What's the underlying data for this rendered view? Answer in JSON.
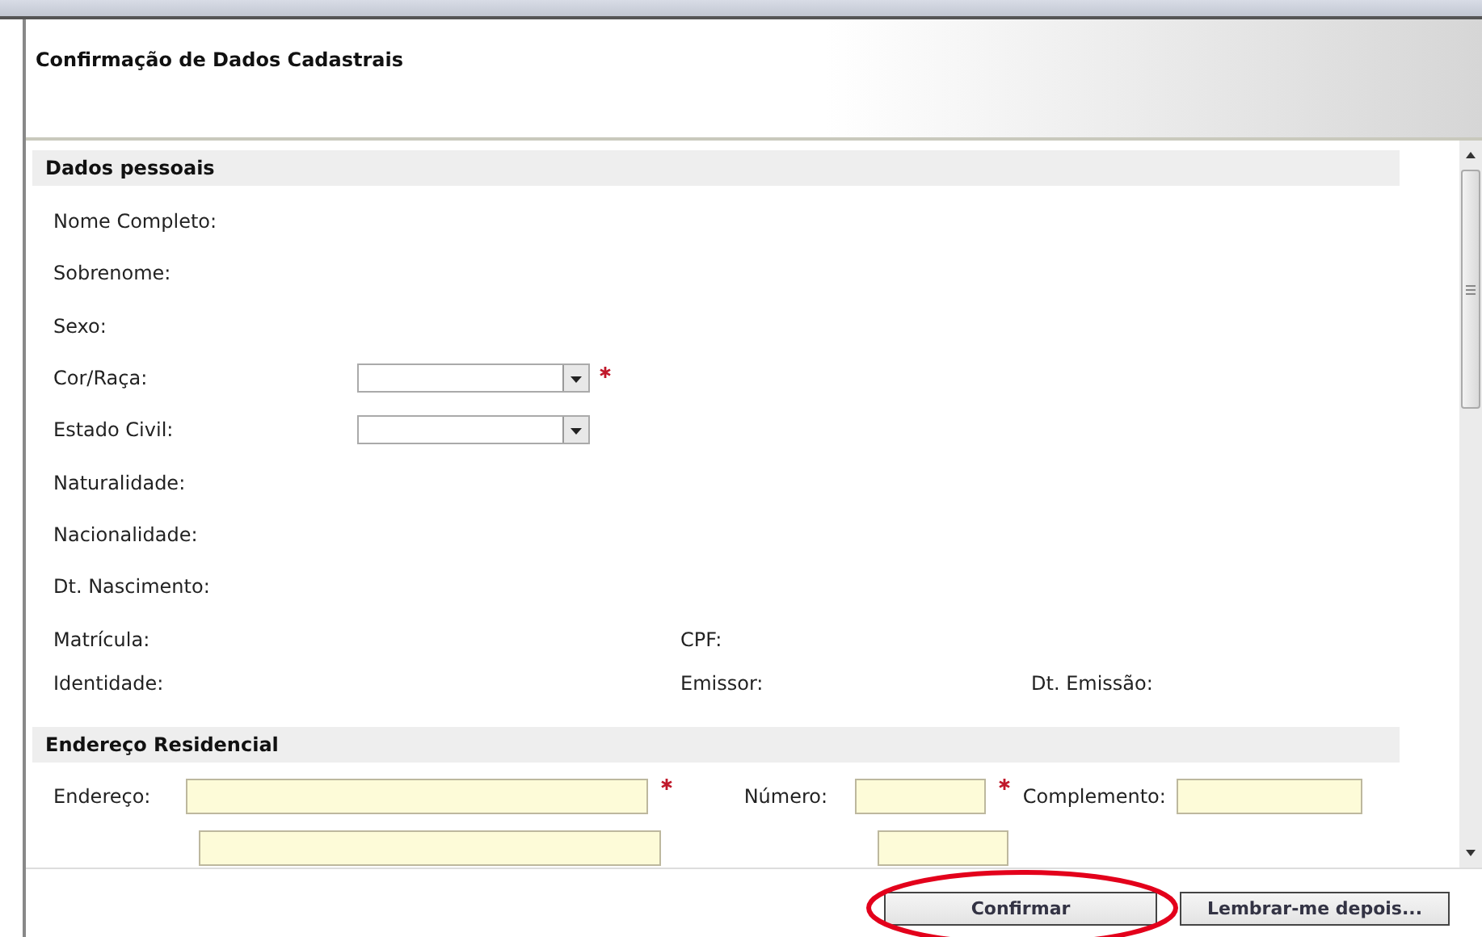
{
  "dialog": {
    "title": "Confirmação de Dados Cadastrais"
  },
  "personal": {
    "heading": "Dados pessoais",
    "rows": [
      {
        "fields": [
          {
            "label": "Nome Completo:",
            "kind": "text"
          }
        ]
      },
      {
        "fields": [
          {
            "label": "Sobrenome:",
            "kind": "text"
          }
        ]
      },
      {
        "fields": [
          {
            "label": "Sexo:",
            "kind": "text"
          }
        ]
      },
      {
        "fields": [
          {
            "label": "Cor/Raça:",
            "kind": "select",
            "required": true
          }
        ]
      },
      {
        "fields": [
          {
            "label": "Estado Civil:",
            "kind": "select"
          }
        ]
      },
      {
        "fields": [
          {
            "label": "Naturalidade:",
            "kind": "text"
          }
        ]
      },
      {
        "fields": [
          {
            "label": "Nacionalidade:",
            "kind": "text"
          }
        ]
      },
      {
        "fields": [
          {
            "label": "Dt. Nascimento:",
            "kind": "text"
          }
        ]
      },
      {
        "fields": [
          {
            "label": "Matrícula:",
            "kind": "text"
          },
          {
            "label": "CPF:",
            "kind": "text"
          }
        ]
      },
      {
        "fields": [
          {
            "label": "Identidade:",
            "kind": "text"
          },
          {
            "label": "Emissor:",
            "kind": "text"
          },
          {
            "label": "Dt. Emissão:",
            "kind": "text"
          }
        ]
      }
    ]
  },
  "address": {
    "heading": "Endereço Residencial",
    "rows": [
      {
        "fields": [
          {
            "label": "Endereço:",
            "kind": "wide",
            "required": true
          },
          {
            "label": "Número:",
            "kind": "short",
            "required": true
          },
          {
            "label": "Complemento:",
            "kind": "medium"
          }
        ]
      },
      {
        "fields": [
          {
            "kind": "wide"
          },
          {
            "kind": "short"
          }
        ]
      }
    ]
  },
  "buttons": [
    {
      "label": "Confirmar",
      "highlighted": true
    },
    {
      "label": "Lembrar-me depois..."
    }
  ]
}
